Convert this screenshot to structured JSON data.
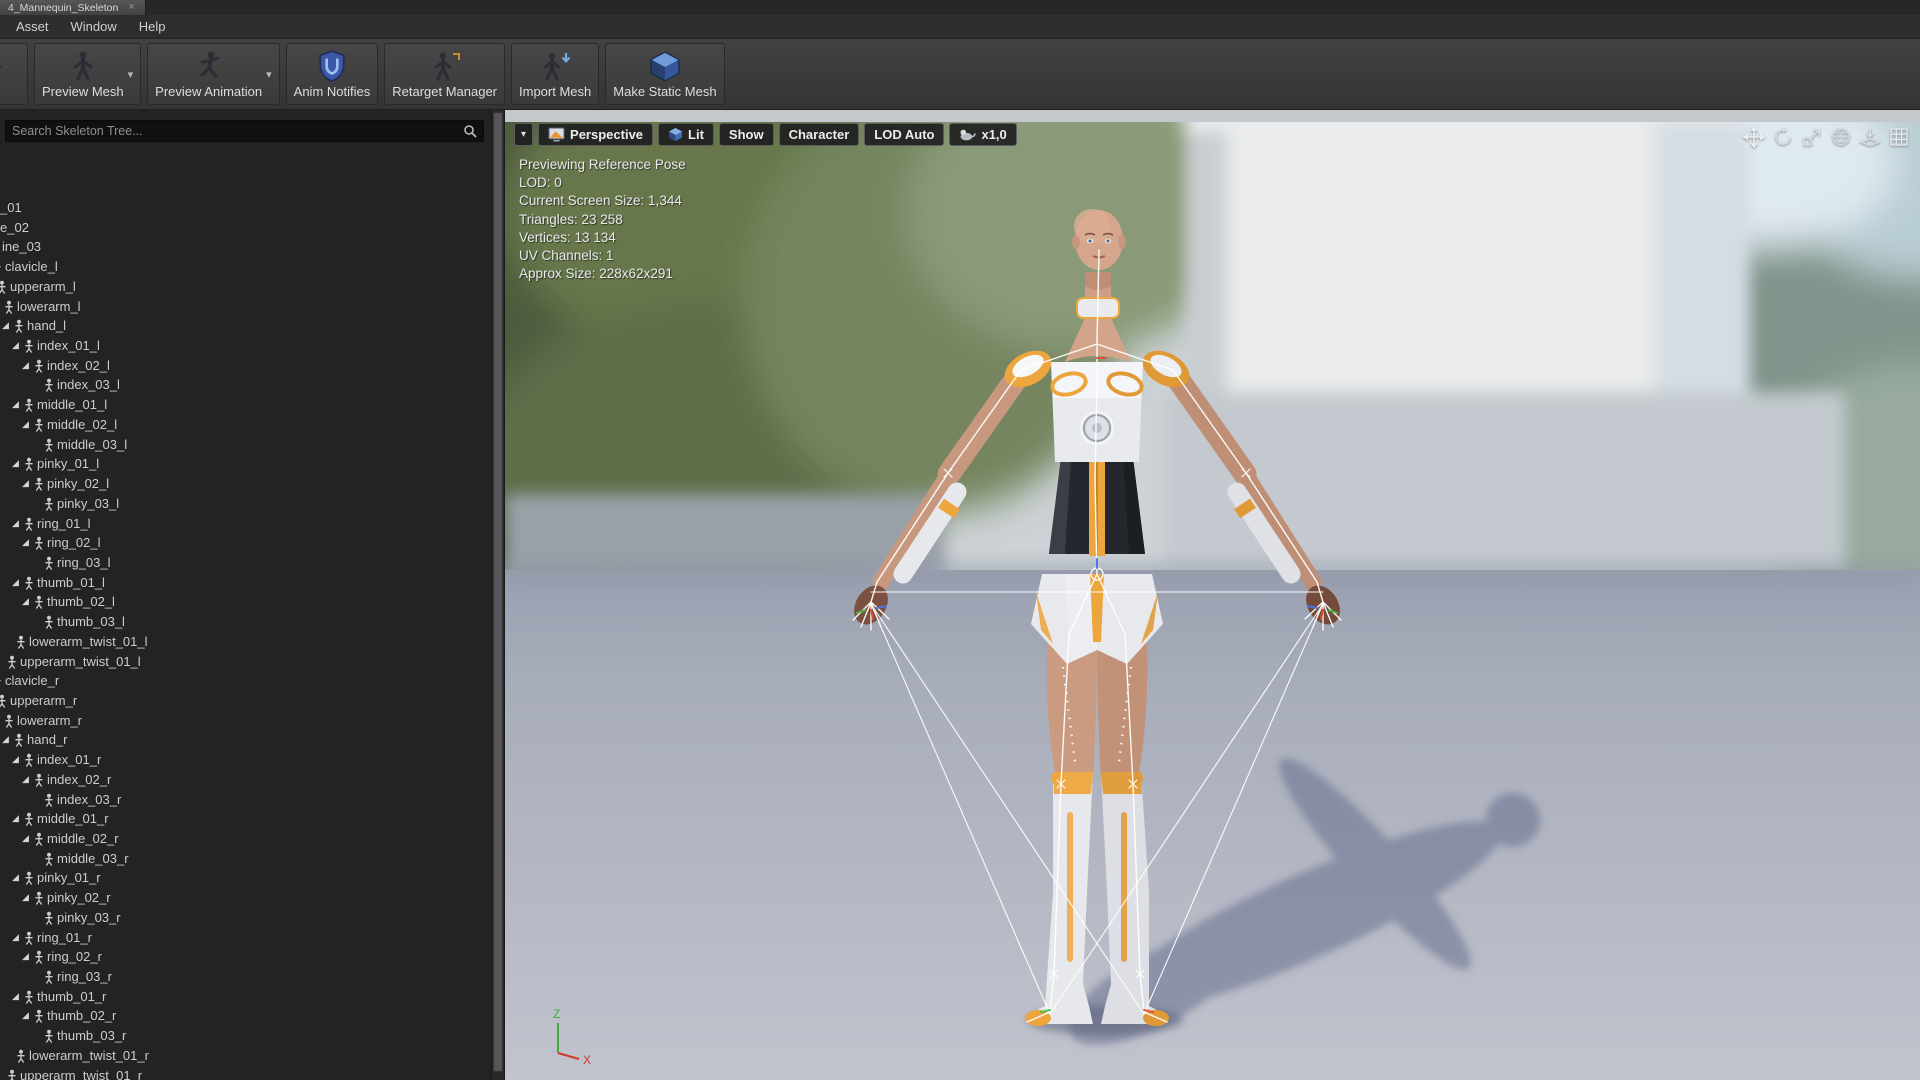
{
  "window": {
    "tab_title": "4_Mannequin_Skeleton",
    "tab_close": "×",
    "menu": [
      "Asset",
      "Window",
      "Help"
    ]
  },
  "toolbar": {
    "buttons": [
      {
        "name": "pose-button",
        "label": "se",
        "icon": "figure-pose",
        "caret": false,
        "cut": true
      },
      {
        "name": "preview-mesh-button",
        "label": "Preview Mesh",
        "icon": "figure-stand",
        "caret": true
      },
      {
        "name": "preview-animation-button",
        "label": "Preview Animation",
        "icon": "figure-run",
        "caret": true
      },
      {
        "name": "anim-notifies-button",
        "label": "Anim Notifies",
        "icon": "shield"
      },
      {
        "name": "retarget-manager-button",
        "label": "Retarget Manager",
        "icon": "figure-retarget"
      },
      {
        "name": "import-mesh-button",
        "label": "Import Mesh",
        "icon": "figure-import"
      },
      {
        "name": "make-static-mesh-button",
        "label": "Make Static Mesh",
        "icon": "cube"
      }
    ]
  },
  "skeleton_tree": {
    "search_placeholder": "Search Skeleton Tree...",
    "items": [
      {
        "label": "_01",
        "x": 0,
        "icon": false
      },
      {
        "label": "e_02",
        "x": 0,
        "icon": false
      },
      {
        "label": "ine_03",
        "x": 2,
        "icon": false
      },
      {
        "label": "clavicle_l",
        "x": 5
      },
      {
        "label": "upperarm_l",
        "x": 10
      },
      {
        "label": "lowerarm_l",
        "x": 17
      },
      {
        "label": "hand_l",
        "x": 27,
        "exp": true
      },
      {
        "label": "index_01_l",
        "x": 37,
        "exp": true
      },
      {
        "label": "index_02_l",
        "x": 47,
        "exp": true
      },
      {
        "label": "index_03_l",
        "x": 57
      },
      {
        "label": "middle_01_l",
        "x": 37,
        "exp": true
      },
      {
        "label": "middle_02_l",
        "x": 47,
        "exp": true
      },
      {
        "label": "middle_03_l",
        "x": 57
      },
      {
        "label": "pinky_01_l",
        "x": 37,
        "exp": true
      },
      {
        "label": "pinky_02_l",
        "x": 47,
        "exp": true
      },
      {
        "label": "pinky_03_l",
        "x": 57
      },
      {
        "label": "ring_01_l",
        "x": 37,
        "exp": true
      },
      {
        "label": "ring_02_l",
        "x": 47,
        "exp": true
      },
      {
        "label": "ring_03_l",
        "x": 57
      },
      {
        "label": "thumb_01_l",
        "x": 37,
        "exp": true
      },
      {
        "label": "thumb_02_l",
        "x": 47,
        "exp": true
      },
      {
        "label": "thumb_03_l",
        "x": 57
      },
      {
        "label": "lowerarm_twist_01_l",
        "x": 29
      },
      {
        "label": "upperarm_twist_01_l",
        "x": 20
      },
      {
        "label": "clavicle_r",
        "x": 5
      },
      {
        "label": "upperarm_r",
        "x": 10
      },
      {
        "label": "lowerarm_r",
        "x": 17
      },
      {
        "label": "hand_r",
        "x": 27,
        "exp": true
      },
      {
        "label": "index_01_r",
        "x": 37,
        "exp": true
      },
      {
        "label": "index_02_r",
        "x": 47,
        "exp": true
      },
      {
        "label": "index_03_r",
        "x": 57
      },
      {
        "label": "middle_01_r",
        "x": 37,
        "exp": true
      },
      {
        "label": "middle_02_r",
        "x": 47,
        "exp": true
      },
      {
        "label": "middle_03_r",
        "x": 57
      },
      {
        "label": "pinky_01_r",
        "x": 37,
        "exp": true
      },
      {
        "label": "pinky_02_r",
        "x": 47,
        "exp": true
      },
      {
        "label": "pinky_03_r",
        "x": 57
      },
      {
        "label": "ring_01_r",
        "x": 37,
        "exp": true
      },
      {
        "label": "ring_02_r",
        "x": 47,
        "exp": true
      },
      {
        "label": "ring_03_r",
        "x": 57
      },
      {
        "label": "thumb_01_r",
        "x": 37,
        "exp": true
      },
      {
        "label": "thumb_02_r",
        "x": 47,
        "exp": true
      },
      {
        "label": "thumb_03_r",
        "x": 57
      },
      {
        "label": "lowerarm_twist_01_r",
        "x": 29
      },
      {
        "label": "upperarm_twist_01_r",
        "x": 20
      }
    ]
  },
  "viewport": {
    "buttons": [
      {
        "name": "viewport-options-button",
        "label": "",
        "icon": "caret"
      },
      {
        "name": "perspective-button",
        "label": "Perspective",
        "icon": "perspective"
      },
      {
        "name": "lit-button",
        "label": "Lit",
        "icon": "lit-cube"
      },
      {
        "name": "show-button",
        "label": "Show"
      },
      {
        "name": "character-button",
        "label": "Character"
      },
      {
        "name": "lod-auto-button",
        "label": "LOD Auto"
      },
      {
        "name": "playback-speed-button",
        "label": "x1,0",
        "icon": "speed"
      }
    ],
    "stats": [
      "Previewing Reference Pose",
      "LOD: 0",
      "Current Screen Size: 1,344",
      "Triangles: 23 258",
      "Vertices: 13 134",
      "UV Channels: 1",
      "Approx Size: 228x62x291"
    ],
    "tools": [
      {
        "name": "translate-tool"
      },
      {
        "name": "rotate-tool"
      },
      {
        "name": "scale-tool"
      },
      {
        "name": "world-space-toggle"
      },
      {
        "name": "surface-snap-toggle"
      },
      {
        "name": "grid-snap-toggle"
      }
    ],
    "axis": {
      "z": "Z",
      "x": "X"
    }
  },
  "colors": {
    "accent_orange": "#eda63e",
    "ue_blue": "#35589c",
    "floor": "#a9aebb"
  }
}
